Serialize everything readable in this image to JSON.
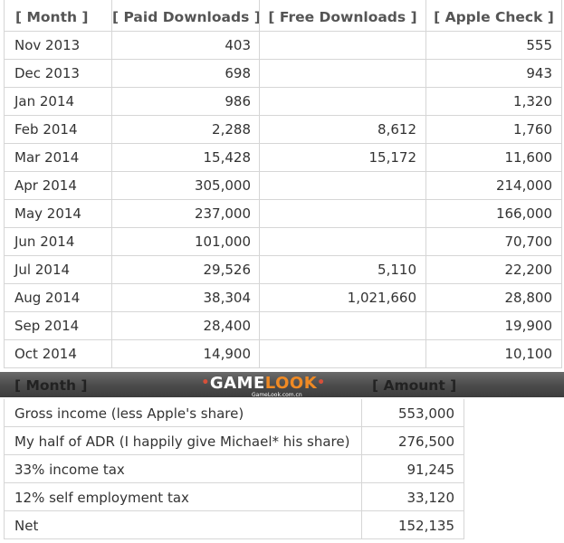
{
  "downloads_table": {
    "headers": {
      "month": "[ Month ]",
      "paid": "[ Paid Downloads ]",
      "free": "[ Free Downloads ]",
      "apple": "[ Apple Check ]"
    },
    "rows": [
      {
        "month": "Nov 2013",
        "paid": "403",
        "free": "",
        "apple": "555"
      },
      {
        "month": "Dec 2013",
        "paid": "698",
        "free": "",
        "apple": "943"
      },
      {
        "month": "Jan 2014",
        "paid": "986",
        "free": "",
        "apple": "1,320"
      },
      {
        "month": "Feb 2014",
        "paid": "2,288",
        "free": "8,612",
        "apple": "1,760"
      },
      {
        "month": "Mar 2014",
        "paid": "15,428",
        "free": "15,172",
        "apple": "11,600"
      },
      {
        "month": "Apr 2014",
        "paid": "305,000",
        "free": "",
        "apple": "214,000"
      },
      {
        "month": "May 2014",
        "paid": "237,000",
        "free": "",
        "apple": "166,000"
      },
      {
        "month": "Jun 2014",
        "paid": "101,000",
        "free": "",
        "apple": "70,700"
      },
      {
        "month": "Jul 2014",
        "paid": "29,526",
        "free": "5,110",
        "apple": "22,200"
      },
      {
        "month": "Aug 2014",
        "paid": "38,304",
        "free": "1,021,660",
        "apple": "28,800"
      },
      {
        "month": "Sep 2014",
        "paid": "28,400",
        "free": "",
        "apple": "19,900"
      },
      {
        "month": "Oct 2014",
        "paid": "14,900",
        "free": "",
        "apple": "10,100"
      }
    ]
  },
  "watermark": {
    "game": "GAME",
    "look": "LOOK",
    "url": "GameLook.com.cn"
  },
  "income_table": {
    "headers": {
      "month": "[ Month ]",
      "amount": "[ Amount ]"
    },
    "rows": [
      {
        "label": "Gross income (less Apple's share)",
        "amount": "553,000"
      },
      {
        "label": "My half of ADR (I happily give Michael* his share)",
        "amount": "276,500"
      },
      {
        "label": "33% income tax",
        "amount": "91,245"
      },
      {
        "label": "12% self employment tax",
        "amount": "33,120"
      },
      {
        "label": "Net",
        "amount": "152,135"
      }
    ]
  },
  "colors": {
    "border": "#d6d6d6",
    "text": "#333333",
    "banner": "#4a4a4a",
    "logo_accent": "#f08a24"
  }
}
